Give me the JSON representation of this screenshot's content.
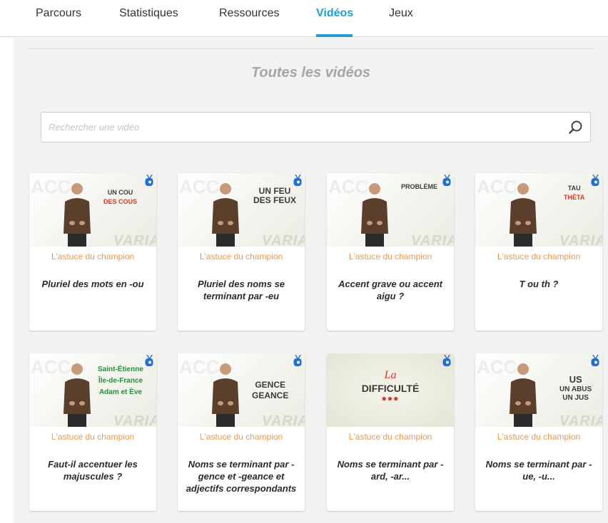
{
  "nav": {
    "tabs": [
      {
        "label": "Parcours"
      },
      {
        "label": "Statistiques"
      },
      {
        "label": "Ressources"
      },
      {
        "label": "Vidéos",
        "active": true
      },
      {
        "label": "Jeux"
      }
    ],
    "accent_color": "#1e9ed6"
  },
  "page": {
    "title": "Toutes les vidéos"
  },
  "search": {
    "placeholder": "Rechercher une vidéo",
    "value": "",
    "icon": "search-icon"
  },
  "videos": [
    {
      "category": "L'astuce du champion",
      "title": "Pluriel des mots en -ou",
      "thumb_text": [
        "UN COU",
        "DES COUS"
      ]
    },
    {
      "category": "L'astuce du champion",
      "title": "Pluriel des noms se terminant par -eu",
      "thumb_text": [
        "UN FEU",
        "DES FEUX"
      ]
    },
    {
      "category": "L'astuce du champion",
      "title": "Accent grave ou accent aigu ?",
      "thumb_text": [
        "PROBLÈME"
      ]
    },
    {
      "category": "L'astuce du champion",
      "title": "T ou th ?",
      "thumb_text": [
        "TAU",
        "THÊTA"
      ]
    },
    {
      "category": "L'astuce du champion",
      "title": "Faut-il accentuer les majuscules ?",
      "thumb_text": [
        "Saint-Étienne",
        "Île-de-France",
        "Adam et Ève"
      ]
    },
    {
      "category": "L'astuce du champion",
      "title": "Noms se terminant par -gence et -geance et adjectifs correspondants",
      "thumb_text": [
        "GENCE",
        "GEANCE"
      ]
    },
    {
      "category": "L'astuce du champion",
      "title": "Noms se terminant par -ard, -ar...",
      "thumb_text": [
        "La",
        "DIFFICULTÉ"
      ]
    },
    {
      "category": "L'astuce du champion",
      "title": "Noms se terminant par -ue, -u...",
      "thumb_text": [
        "US",
        "UN ABUS",
        "UN JUS"
      ]
    }
  ],
  "colors": {
    "category": "#e89a54",
    "title": "#2b2b2b",
    "page_title": "#a6a6a6",
    "background": "#f2f2f2",
    "highlight_red": "#d23b2a",
    "highlight_green": "#2e8a3b"
  }
}
